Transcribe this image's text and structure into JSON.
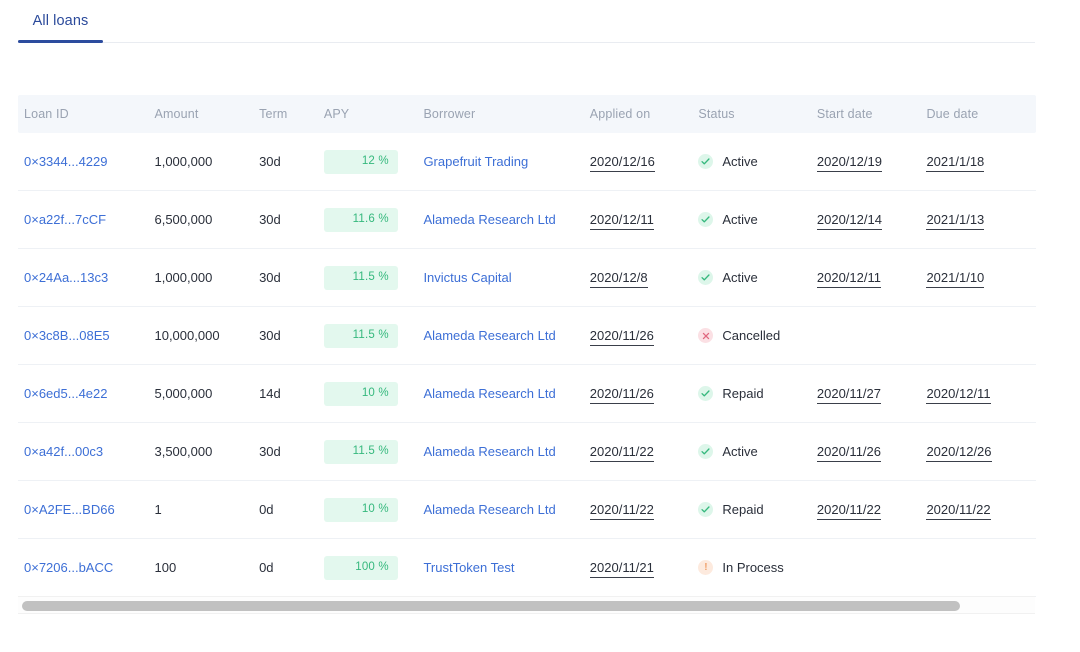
{
  "tabs": [
    {
      "label": "All loans",
      "active": true
    }
  ],
  "table": {
    "columns": [
      {
        "key": "loan_id",
        "label": "Loan ID"
      },
      {
        "key": "amount",
        "label": "Amount"
      },
      {
        "key": "term",
        "label": "Term"
      },
      {
        "key": "apy",
        "label": "APY"
      },
      {
        "key": "borrower",
        "label": "Borrower"
      },
      {
        "key": "applied_on",
        "label": "Applied on"
      },
      {
        "key": "status",
        "label": "Status"
      },
      {
        "key": "start_date",
        "label": "Start date"
      },
      {
        "key": "due_date",
        "label": "Due date"
      }
    ],
    "rows": [
      {
        "loan_id": "0×3344...4229",
        "amount": "1,000,000",
        "term": "30d",
        "apy": "12 %",
        "borrower": "Grapefruit Trading",
        "applied_on": "2020/12/16",
        "status": "Active",
        "status_icon": "check-icon",
        "start_date": "2020/12/19",
        "due_date": "2021/1/18"
      },
      {
        "loan_id": "0×a22f...7cCF",
        "amount": "6,500,000",
        "term": "30d",
        "apy": "11.6 %",
        "borrower": "Alameda Research Ltd",
        "applied_on": "2020/12/11",
        "status": "Active",
        "status_icon": "check-icon",
        "start_date": "2020/12/14",
        "due_date": "2021/1/13"
      },
      {
        "loan_id": "0×24Aa...13c3",
        "amount": "1,000,000",
        "term": "30d",
        "apy": "11.5 %",
        "borrower": "Invictus Capital",
        "applied_on": "2020/12/8",
        "status": "Active",
        "status_icon": "check-icon",
        "start_date": "2020/12/11",
        "due_date": "2021/1/10"
      },
      {
        "loan_id": "0×3c8B...08E5",
        "amount": "10,000,000",
        "term": "30d",
        "apy": "11.5 %",
        "borrower": "Alameda Research Ltd",
        "applied_on": "2020/11/26",
        "status": "Cancelled",
        "status_icon": "x-icon",
        "start_date": "",
        "due_date": ""
      },
      {
        "loan_id": "0×6ed5...4e22",
        "amount": "5,000,000",
        "term": "14d",
        "apy": "10 %",
        "borrower": "Alameda Research Ltd",
        "applied_on": "2020/11/26",
        "status": "Repaid",
        "status_icon": "check-icon",
        "start_date": "2020/11/27",
        "due_date": "2020/12/11"
      },
      {
        "loan_id": "0×a42f...00c3",
        "amount": "3,500,000",
        "term": "30d",
        "apy": "11.5 %",
        "borrower": "Alameda Research Ltd",
        "applied_on": "2020/11/22",
        "status": "Active",
        "status_icon": "check-icon",
        "start_date": "2020/11/26",
        "due_date": "2020/12/26"
      },
      {
        "loan_id": "0×A2FE...BD66",
        "amount": "1",
        "term": "0d",
        "apy": "10 %",
        "borrower": "Alameda Research Ltd",
        "applied_on": "2020/11/22",
        "status": "Repaid",
        "status_icon": "check-icon",
        "start_date": "2020/11/22",
        "due_date": "2020/11/22"
      },
      {
        "loan_id": "0×7206...bACC",
        "amount": "100",
        "term": "0d",
        "apy": "100 %",
        "borrower": "TrustToken Test",
        "applied_on": "2020/11/21",
        "status": "In Process",
        "status_icon": "exclamation-icon",
        "start_date": "",
        "due_date": ""
      }
    ]
  },
  "colors": {
    "tab_active": "#2c4c9e",
    "link": "#3d6fd6",
    "apy_badge_bg": "#e3f8ee",
    "apy_text": "#35b87d",
    "status_ok": "#35b87d",
    "status_cancelled": "#e0677e",
    "status_pending": "#f0a06a",
    "header_bg": "#f4f7fb"
  },
  "scrollbar": {
    "orientation": "horizontal",
    "thumb_label": "horizontal-scroll-thumb"
  }
}
